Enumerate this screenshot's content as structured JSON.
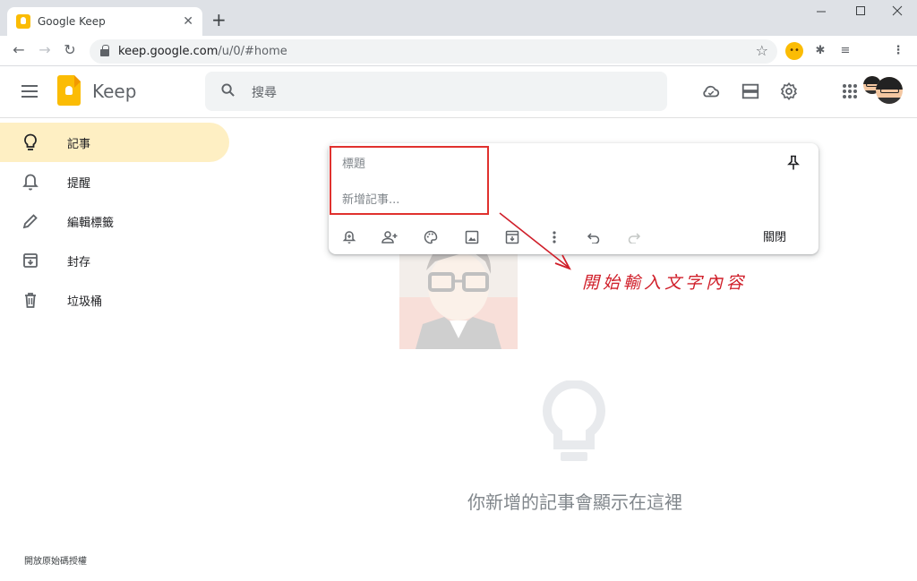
{
  "browser": {
    "tab_title": "Google Keep",
    "url_host": "keep.google.com",
    "url_path": "/u/0/#home",
    "new_tab_icon": "plus-icon",
    "minimize_icon": "minimize-icon",
    "maximize_icon": "maximize-icon",
    "close_icon": "close-icon"
  },
  "app": {
    "name": "Keep",
    "search_placeholder": "搜尋",
    "accent": "#fbbc04",
    "active_bg": "#feefc3"
  },
  "sidebar": {
    "items": [
      {
        "label": "記事",
        "icon": "lightbulb-icon",
        "active": true
      },
      {
        "label": "提醒",
        "icon": "bell-icon",
        "active": false
      },
      {
        "label": "編輯標籤",
        "icon": "pencil-icon",
        "active": false
      },
      {
        "label": "封存",
        "icon": "archive-icon",
        "active": false
      },
      {
        "label": "垃圾桶",
        "icon": "trash-icon",
        "active": false
      }
    ],
    "footer": "開放原始碼授權"
  },
  "composer": {
    "title_placeholder": "標題",
    "body_placeholder": "新增記事...",
    "close_label": "關閉"
  },
  "annotation": {
    "text": "開始輸入文字內容",
    "color": "#d01f2a"
  },
  "empty_state": {
    "message": "你新增的記事會顯示在這裡"
  }
}
